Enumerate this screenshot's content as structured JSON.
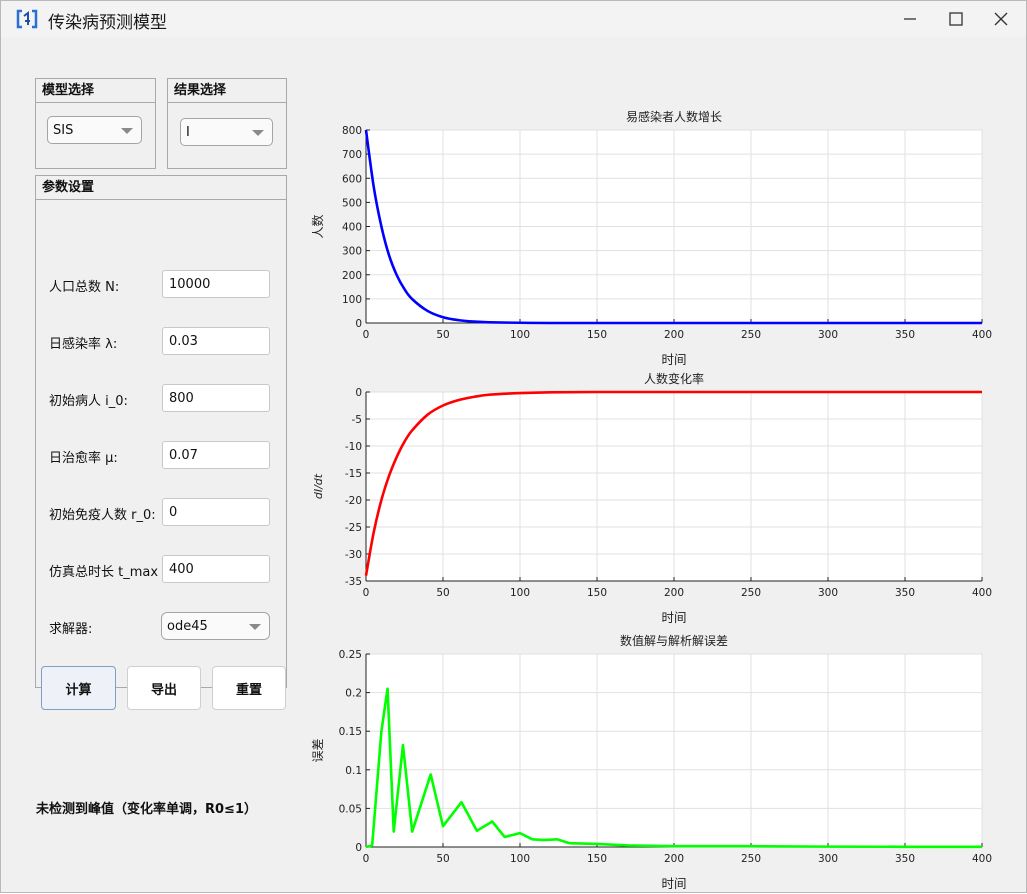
{
  "window": {
    "title": "传染病预测模型",
    "icon": "app-logo-icon",
    "controls": [
      "minimize-icon",
      "maximize-icon",
      "close-icon"
    ]
  },
  "model_group": {
    "title": "模型选择",
    "selected": "SIS"
  },
  "result_group": {
    "title": "结果选择",
    "selected": "I"
  },
  "params_group": {
    "title": "参数设置",
    "fields": [
      {
        "label": "人口总数 N:",
        "value": "10000"
      },
      {
        "label": "日感染率 λ:",
        "value": "0.03"
      },
      {
        "label": "初始病人 i_0:",
        "value": "800"
      },
      {
        "label": "日治愈率 μ:",
        "value": "0.07"
      },
      {
        "label": "初始免疫人数 r_0:",
        "value": "0"
      },
      {
        "label": "仿真总时长 t_max",
        "value": "400"
      }
    ],
    "solver": {
      "label": "求解器:",
      "value": "ode45"
    }
  },
  "buttons": {
    "compute": "计算",
    "export": "导出",
    "reset": "重置"
  },
  "status_text": "未检测到峰值（变化率单调，R0≤1）",
  "colors": {
    "susceptible": "#0000ff",
    "rate": "#ff0000",
    "error": "#00ff00"
  },
  "chart_data": [
    {
      "type": "line",
      "title": "易感染者人数增长",
      "xlabel": "时间",
      "ylabel": "人数",
      "xlim": [
        0,
        400
      ],
      "ylim": [
        0,
        800
      ],
      "xticks": [
        0,
        50,
        100,
        150,
        200,
        250,
        300,
        350,
        400
      ],
      "yticks": [
        0,
        100,
        200,
        300,
        400,
        500,
        600,
        700,
        800
      ],
      "grid": true,
      "series": [
        {
          "x": [
            0,
            5,
            10,
            15,
            20,
            25,
            30,
            40,
            50,
            60,
            70,
            80,
            100,
            120,
            150,
            200,
            300,
            400
          ],
          "y": [
            800,
            565,
            400,
            280,
            198,
            140,
            99,
            50,
            24,
            12,
            6,
            3,
            1,
            0,
            0,
            0,
            0,
            0
          ]
        }
      ]
    },
    {
      "type": "line",
      "title": "人数变化率",
      "xlabel": "时间",
      "ylabel": "dI/dt",
      "xlim": [
        0,
        400
      ],
      "ylim": [
        -35,
        0
      ],
      "xticks": [
        0,
        50,
        100,
        150,
        200,
        250,
        300,
        350,
        400
      ],
      "yticks": [
        -35,
        -30,
        -25,
        -20,
        -15,
        -10,
        -5,
        0
      ],
      "grid": true,
      "series": [
        {
          "x": [
            0,
            5,
            10,
            15,
            20,
            25,
            30,
            40,
            50,
            60,
            70,
            80,
            100,
            120,
            150,
            200,
            300,
            400
          ],
          "y": [
            -34,
            -26,
            -20,
            -15.5,
            -12,
            -9.2,
            -7.1,
            -4.2,
            -2.5,
            -1.5,
            -0.9,
            -0.5,
            -0.2,
            -0.05,
            0,
            0,
            0,
            0
          ]
        }
      ]
    },
    {
      "type": "line",
      "title": "数值解与解析解误差",
      "xlabel": "时间",
      "ylabel": "误差",
      "xlim": [
        0,
        400
      ],
      "ylim": [
        0,
        0.25
      ],
      "xticks": [
        0,
        50,
        100,
        150,
        200,
        250,
        300,
        350,
        400
      ],
      "yticks": [
        0,
        0.05,
        0.1,
        0.15,
        0.2,
        0.25
      ],
      "grid": true,
      "series": [
        {
          "x": [
            0,
            4,
            10,
            14,
            18,
            24,
            30,
            42,
            50,
            62,
            72,
            82,
            90,
            100,
            108,
            116,
            124,
            132,
            150,
            170,
            200,
            250,
            300,
            350,
            400
          ],
          "y": [
            0,
            0.002,
            0.15,
            0.205,
            0.02,
            0.132,
            0.02,
            0.094,
            0.027,
            0.058,
            0.021,
            0.033,
            0.013,
            0.018,
            0.01,
            0.009,
            0.01,
            0.005,
            0.004,
            0.002,
            0.001,
            0.001,
            0.0005,
            0.0003,
            0.0002
          ]
        }
      ]
    }
  ]
}
